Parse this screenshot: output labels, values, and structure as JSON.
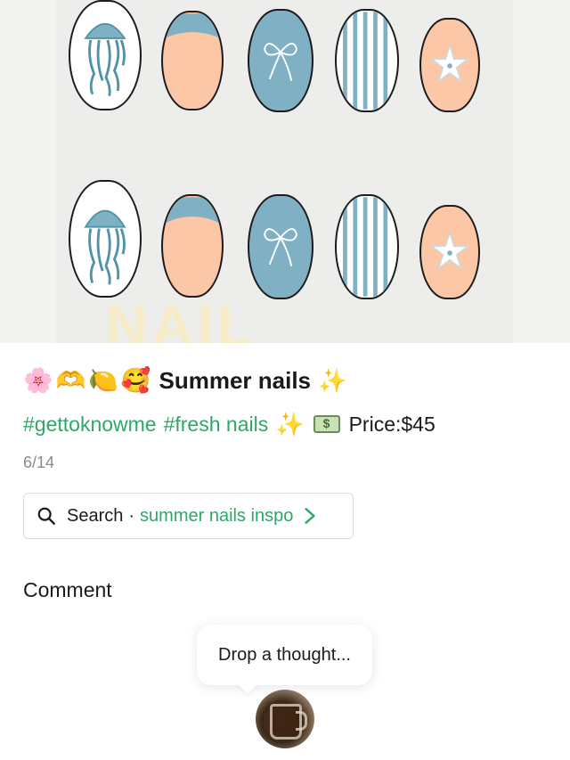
{
  "hero": {
    "watermark_text": "NAIL INSPO",
    "nail_designs": [
      "jellyfish",
      "french-tip",
      "bow",
      "stripes",
      "starfish"
    ],
    "colors": {
      "blue": "#7fb0c3",
      "peach": "#fbc7a6",
      "white": "#ffffff",
      "outline": "#1c1c1c"
    }
  },
  "post": {
    "title_emojis": [
      "🌸",
      "🫶",
      "🍋",
      "🥰"
    ],
    "title": "Summer nails",
    "title_trailing_emoji": "✨",
    "tags": [
      "#gettoknowme",
      "#fresh nails"
    ],
    "tags_emoji": "✨",
    "price": "Price:$45",
    "date": "6/14"
  },
  "search": {
    "label": "Search",
    "separator": "·",
    "query": "summer nails inspo"
  },
  "comments": {
    "title": "Comment",
    "prompt": "Drop a thought..."
  },
  "theme": {
    "accent_green": "#2da867",
    "muted_gray": "#8a8a8a"
  }
}
